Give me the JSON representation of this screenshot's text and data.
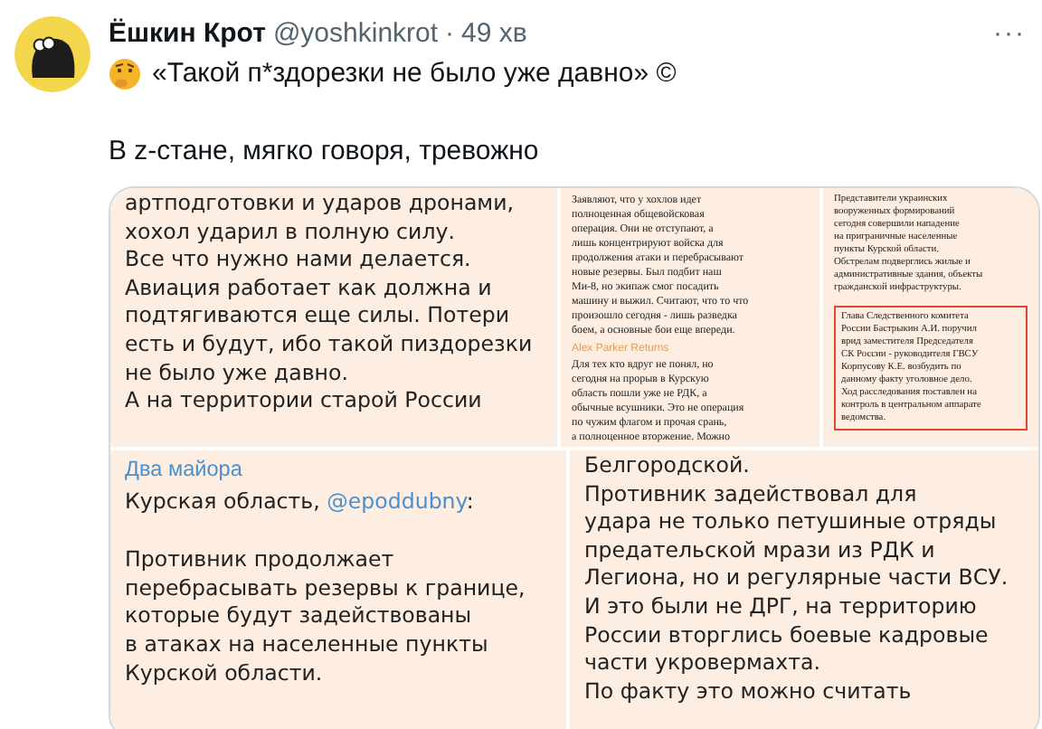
{
  "tweet": {
    "author": "Ёшкин Крот",
    "handle": "@yoshkinkrot",
    "separator": "·",
    "time": "49 хв",
    "more": "···",
    "lines": [
      {
        "kind": "emoji_line",
        "text": "«Такой п*здорезки не было уже давно» ©"
      },
      {
        "kind": "gap"
      },
      {
        "kind": "plain",
        "text": "В z-стане, мягко говоря, тревожно"
      }
    ]
  },
  "images": [
    {
      "kind": "large_post",
      "blocks": [
        {
          "kind": "text",
          "lines": [
            "артподготовки и ударов дронами,",
            "хохол ударил в полную силу.",
            "Все что нужно нами делается.",
            "Авиация работает как должна и",
            "подтягиваются еще силы. Потери",
            "есть и будут, ибо такой пиздорезки",
            "не было уже давно.",
            "А на территории старой России"
          ]
        }
      ]
    },
    {
      "kind": "small_post",
      "blocks": [
        {
          "kind": "text",
          "lines": [
            "Заявляют, что у хохлов идет",
            "полноценная общевойсковая",
            "операция. Они не отступают, а",
            "лишь концентрируют войска для",
            "продолжения атаки и перебрасывают",
            "новые резервы. Был подбит наш",
            "Ми-8, но экипаж смог посадить",
            "машину и выжил. Считают, что то что",
            "произошло сегодня - лишь разведка",
            "боем, а основные бои еще впереди."
          ]
        },
        {
          "kind": "author",
          "text": "Alex Parker Returns"
        },
        {
          "kind": "text",
          "lines": [
            "Для тех кто вдруг не понял, но",
            "сегодня на прорыв в Курскую",
            "область пошли уже не РДК, а",
            "обычные всушники. Это не операция",
            "по чужим флагом и прочая срань,",
            "а полноценное вторжение. Можно"
          ]
        }
      ]
    },
    {
      "kind": "tiny_post",
      "blocks": [
        {
          "kind": "text",
          "lines": [
            "Представители украинских",
            "вооруженных формирований",
            "сегодня совершили нападение",
            "на приграничные населенные",
            "пункты Курской области.",
            "Обстрелам подверглись жилые и",
            "административные здания, объекты",
            "гражданской инфраструктуры."
          ]
        },
        {
          "kind": "highlight",
          "lines": [
            "Глава Следственного комитета",
            "России Бастрыкин А.И. поручил",
            "врид заместителя Председателя",
            "СК России - руководителя ГВСУ",
            "Корпусову К.Е. возбудить по",
            "данному факту уголовное дело.",
            "Ход расследования поставлен на",
            "контроль в центральном аппарате",
            "ведомства."
          ]
        }
      ]
    },
    {
      "kind": "large_post",
      "blocks": [
        {
          "kind": "author",
          "text": "Два майора"
        },
        {
          "kind": "mention",
          "text": "Курская область, ",
          "link": "@epoddubny",
          "after": ":"
        },
        {
          "kind": "gap"
        },
        {
          "kind": "text",
          "lines": [
            "Противник продолжает",
            "перебрасывать резервы к границе,",
            "которые будут задействованы",
            "в атаках на населенные пункты",
            "Курской области."
          ]
        }
      ]
    },
    {
      "kind": "large_post",
      "blocks": [
        {
          "kind": "text",
          "lines": [
            "Белгородской.",
            "Противник задействовал для",
            "удара не только петушиные отряды",
            "предательской мрази из РДК и",
            "Легиона, но и регулярные части ВСУ.",
            "И это были не ДРГ, на территорию",
            "России вторглись боевые кадровые",
            "части укровермахта.",
            "По факту это можно считать"
          ]
        }
      ]
    }
  ]
}
